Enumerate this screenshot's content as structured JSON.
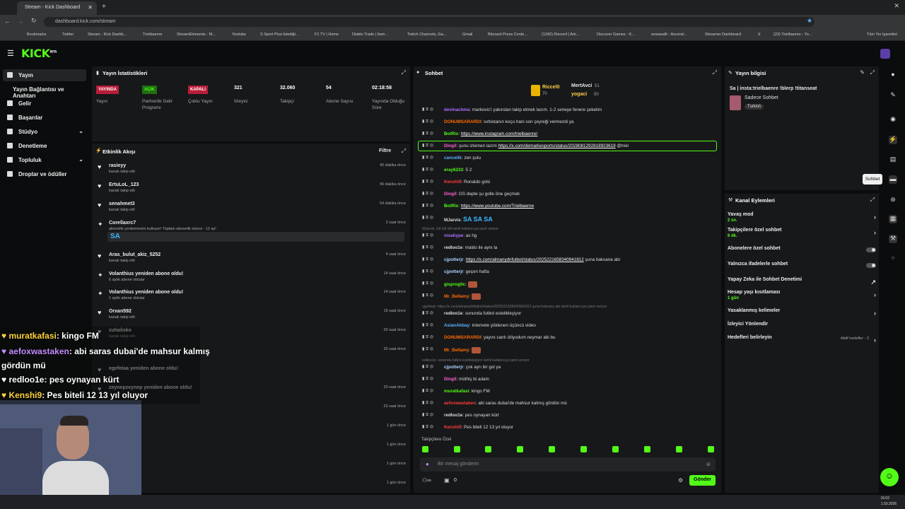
{
  "browser": {
    "tab_title": "Stream - Kick Dashboard",
    "url": "dashboard.kick.com/stream",
    "bookmarks": [
      "Bookmarks",
      "Twitter",
      "Stream - Kick Dashb...",
      "Trielbaenre",
      "StreamElements - M...",
      "Youtube",
      "S Sport Plus-İstediği...",
      "F1 TV | Home",
      "Diablo Trade | Item...",
      "Twitch Channels, Ga...",
      "Gmail",
      "Blizzard Press Cente...",
      "(1342) Discord | Ark...",
      "Discover Games - K...",
      "wowaudit - Ascend...",
      "Streamer Dashboard",
      "X",
      "(23) Trielbaenre - Yo...",
      "Tüm Yer İşaretleri"
    ]
  },
  "header": {
    "logo": "KICK",
    "logo_sup": "BETA"
  },
  "sidebar": {
    "items": [
      "Yayın",
      "Yayın Bağlantısı ve Anahtarı",
      "Gelir",
      "Başarılar",
      "Stüdyo",
      "Denetleme",
      "Topluluk",
      "Droplar ve ödüller"
    ]
  },
  "stats": {
    "title": "Yayın İstatistikleri",
    "items": [
      {
        "badge": "YAYINDA",
        "label": "Yayın",
        "color": "#e11d48"
      },
      {
        "badge": "AÇIK",
        "label": "Partnerlik Gelir Programı",
        "color": "#53fc18"
      },
      {
        "badge": "KAPALI",
        "label": "Çoklu Yayın",
        "color": "#e11d48"
      },
      {
        "value": "321",
        "label": "İzleyici"
      },
      {
        "value": "32.060",
        "label": "Takipçi"
      },
      {
        "value": "54",
        "label": "Abone Sayısı"
      },
      {
        "value": "02:18:58",
        "label": "Yayında Olduğu Süre"
      }
    ]
  },
  "activity": {
    "title": "Etkinlik Akışı",
    "filter": "Filtre",
    "items": [
      {
        "name": "rasieyy",
        "sub": "kanalı takip etti",
        "time": "40 dakika önce"
      },
      {
        "name": "ErtuLoL_123",
        "sub": "kanalı takip etti",
        "time": "40 dakika önce"
      },
      {
        "name": "senahmet3",
        "sub": "kanalı takip etti",
        "time": "54 dakika önce"
      },
      {
        "name": "Corellaxrc7",
        "sub": "abonelik yenilemesini kutluyor! Toplam abonelik süresi - 12 ay!",
        "time": "2 saat önce",
        "emote": "SA"
      },
      {
        "name": "Aras_bulut_akiz_5252",
        "sub": "kanalı takip etti",
        "time": "4 saat önce"
      },
      {
        "name": "Volanthius yeniden abone oldu!",
        "sub": "6 aylık abone oldular",
        "time": "14 saat önce"
      },
      {
        "name": "Volanthius yeniden abone oldu!",
        "sub": "1 aylık abone oldular",
        "time": "14 saat önce"
      },
      {
        "name": "Orxan592",
        "sub": "kanalı takip etti",
        "time": "19 saat önce"
      },
      {
        "name": "zuhalisko",
        "sub": "kanalı takip etti",
        "time": "20 saat önce"
      },
      {
        "name": "",
        "sub": "",
        "time": "20 saat önce"
      },
      {
        "name": "egefelaa yeniden abone oldu!",
        "sub": "",
        "time": ""
      },
      {
        "name": "zeynepzeynep yeniden abone oldu!",
        "sub": "",
        "time": "23 saat önce"
      },
      {
        "name": "",
        "sub": "",
        "time": "23 saat önce"
      },
      {
        "name": "",
        "sub": "",
        "time": "1 gün önce"
      },
      {
        "name": "",
        "sub": "",
        "time": "1 gün önce"
      },
      {
        "name": "",
        "sub": "",
        "time": "1 gün önce"
      },
      {
        "name": "",
        "sub": "",
        "time": "1 gün önce"
      }
    ]
  },
  "chat": {
    "title": "Sohbet",
    "top": [
      {
        "name": "Riccel0",
        "val": "70"
      },
      {
        "name": "MertAvci",
        "val": "51"
      },
      {
        "name": "yogaci",
        "val": "50"
      }
    ],
    "messages": [
      {
        "user": "devinachma",
        "color": "#a970ff",
        "text": "markovic'i yakından takip etmek lazım. 1-2 seneye fenere çekelim"
      },
      {
        "user": "DONUMSARARDI",
        "color": "#ff6a00",
        "text": "sırbistanın koçu hani son çeyreği vermezdi ya"
      },
      {
        "user": "BotRix",
        "color": "#53fc18",
        "text": "",
        "link": "https://www.instagram.com/trielbaenre/"
      },
      {
        "user": "Dingil",
        "color": "#ff5fd2",
        "text": "şunu izlemen lazım",
        "link": "https://x.com/demarkesports/status/2028081292818923619",
        "after": " @triel",
        "highlight": true
      },
      {
        "user": "cancelik",
        "color": "#5ab0ff",
        "text": "zen şutu"
      },
      {
        "user": "eray6233",
        "color": "#53fc18",
        "text": "5 2"
      },
      {
        "user": "Kenshi9",
        "color": "#ff3b3b",
        "text": "Ronaldo golü"
      },
      {
        "user": "Dingil",
        "color": "#ff5fd2",
        "text": "GS depte şu golle öne geçmek"
      },
      {
        "user": "BotRix",
        "color": "#53fc18",
        "text": "",
        "link": "https://www.youtube.com/Trielbaenre"
      },
      {
        "user": "MJarvis",
        "color": "#ddd",
        "text": "SA SA SA"
      },
      {
        "user": "nisahype",
        "color": "#a970ff",
        "text": "as hg"
      },
      {
        "user": "redloo1e",
        "color": "#ddd",
        "text": "maldo ile aynı la"
      },
      {
        "user": "cjpotterjr",
        "color": "#aad4ff",
        "text": "",
        "link": "https://x.com/almanydnfutbol/status/2025221658340941812",
        "after": " şuna baksana abi"
      },
      {
        "user": "cjpotterjr",
        "color": "#aad4ff",
        "text": "geçen hafta"
      },
      {
        "user": "gisproglic",
        "color": "#53fc18",
        "text": ""
      },
      {
        "user": "Mr_Bellamy",
        "color": "#ff6a00",
        "text": ""
      },
      {
        "user": "redloo1e",
        "color": "#ddd",
        "text": "sonunda futbol estetikleşiyor"
      },
      {
        "user": "AsianAkbay",
        "color": "#5ab0ff",
        "text": "internete yüklenen üçüncü video"
      },
      {
        "user": "DONUMSARARDI",
        "color": "#ff6a00",
        "text": "yayını canlı izliyodum neymar abi bu"
      },
      {
        "user": "Mr_Bellamy",
        "color": "#ff6a00",
        "text": ""
      },
      {
        "user": "cjpotterjr",
        "color": "#aad4ff",
        "text": "çok ayrı bir gol ya"
      },
      {
        "user": "Dingil",
        "color": "#ff5fd2",
        "text": "müthiş bi adam"
      },
      {
        "user": "muratkafasi",
        "color": "#53fc18",
        "text": "kingo FM"
      },
      {
        "user": "aefoxwastaken",
        "color": "#ff3b3b",
        "text": "abi saras dubai'de mahsur kalmış gördün mü"
      },
      {
        "user": "redloo1e",
        "color": "#ddd",
        "text": "pes oynayan kürt"
      },
      {
        "user": "Kenshi9",
        "color": "#ff3b3b",
        "text": "Pes biteli 12 13 yıl oluyor"
      }
    ],
    "replies": [
      "MJarvis: SA SA SA isimli kullanıcıya yanıt veriyor",
      "cjpotterjr: https://x.com/almanydnfutbol/status/2025221658340941812 şuna baksana abi isimli kullanıcıya yanıt veriyor",
      "redloo1e: sonunda futbol estetikleşiyor isimli kullanıcıya yanıt veriyor"
    ],
    "mode": "Takipçilere Özel",
    "placeholder": "Bir mesaj gönderin",
    "send": "Gönder",
    "count": "0"
  },
  "stream_info": {
    "title": "Yayın bilgisi",
    "stream_title": "Sa | insta:trielbaenre !blerp !titanseat",
    "category": "Sadece Sohbet",
    "language": "Turkish"
  },
  "actions": {
    "title": "Kanal Eylemleri",
    "items": [
      {
        "label": "Yavaş mod",
        "sub": "2 sn.",
        "ctrl": "chev"
      },
      {
        "label": "Takipçilere özel sohbet",
        "sub": "6 dk.",
        "ctrl": "chev"
      },
      {
        "label": "Abonelere özel sohbet",
        "sub": "",
        "ctrl": "toggle"
      },
      {
        "label": "Yalnızca ifadelerle sohbet",
        "sub": "",
        "ctrl": "toggle"
      },
      {
        "label": "Yapay Zeka ile Sohbet Denetimi",
        "sub": "",
        "ctrl": "ext"
      },
      {
        "label": "Hesap yaşı kısıtlaması",
        "sub": "1 gün",
        "ctrl": "chev"
      },
      {
        "label": "Yasaklanmış kelimeler",
        "sub": "",
        "ctrl": "chev"
      },
      {
        "label": "İzleyici Yönlendir",
        "sub": "",
        "ctrl": ""
      },
      {
        "label": "Hedefleri belirleyin",
        "sub": "",
        "ctrl": "chev",
        "right": "Aktif hedefler - 2"
      }
    ]
  },
  "tooltip": "Sohbet",
  "overlay": [
    {
      "user": "muratkafasi",
      "text": ": kingo FM",
      "color": "#ffd23c"
    },
    {
      "user": "aefoxwastaken",
      "text": ": abi saras dubai'de mahsur kalmış",
      "color": "#c38cff"
    },
    {
      "user": "",
      "text": "gördün mü",
      "color": "#fff"
    },
    {
      "user": "redloo1e",
      "text": ": pes oynayan kürt",
      "color": "#fff"
    },
    {
      "user": "Kenshi9",
      "text": ": Pes biteli 12 13 yıl oluyor",
      "color": "#ffd23c"
    }
  ],
  "taskbar": {
    "time": "16:02",
    "date": "1.03.2026"
  }
}
